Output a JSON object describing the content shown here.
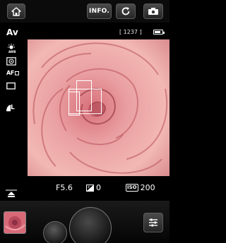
{
  "toolbar": {
    "home_icon": "home-icon",
    "info_label": "INFO.",
    "refresh_icon": "refresh-icon",
    "camera_icon": "camera-icon"
  },
  "status": {
    "mode": "Av",
    "shots_remaining": "[ 1237 ]",
    "battery_level": 0.8
  },
  "settings_icons": {
    "white_balance": "auto-white-balance-icon",
    "metering": "evaluative-metering-icon",
    "af_label": "AF",
    "drive": "single-shot-icon",
    "quality_label": "L"
  },
  "exposure": {
    "aperture": "F5.6",
    "exposure_comp": "0",
    "iso_badge": "ISO",
    "iso": "200"
  },
  "colors": {
    "toolbar_bg": "#0b0b0b",
    "button_bg": "#3a3a3a",
    "rose_light": "#f0a9a6",
    "rose_dark": "#c75860"
  }
}
